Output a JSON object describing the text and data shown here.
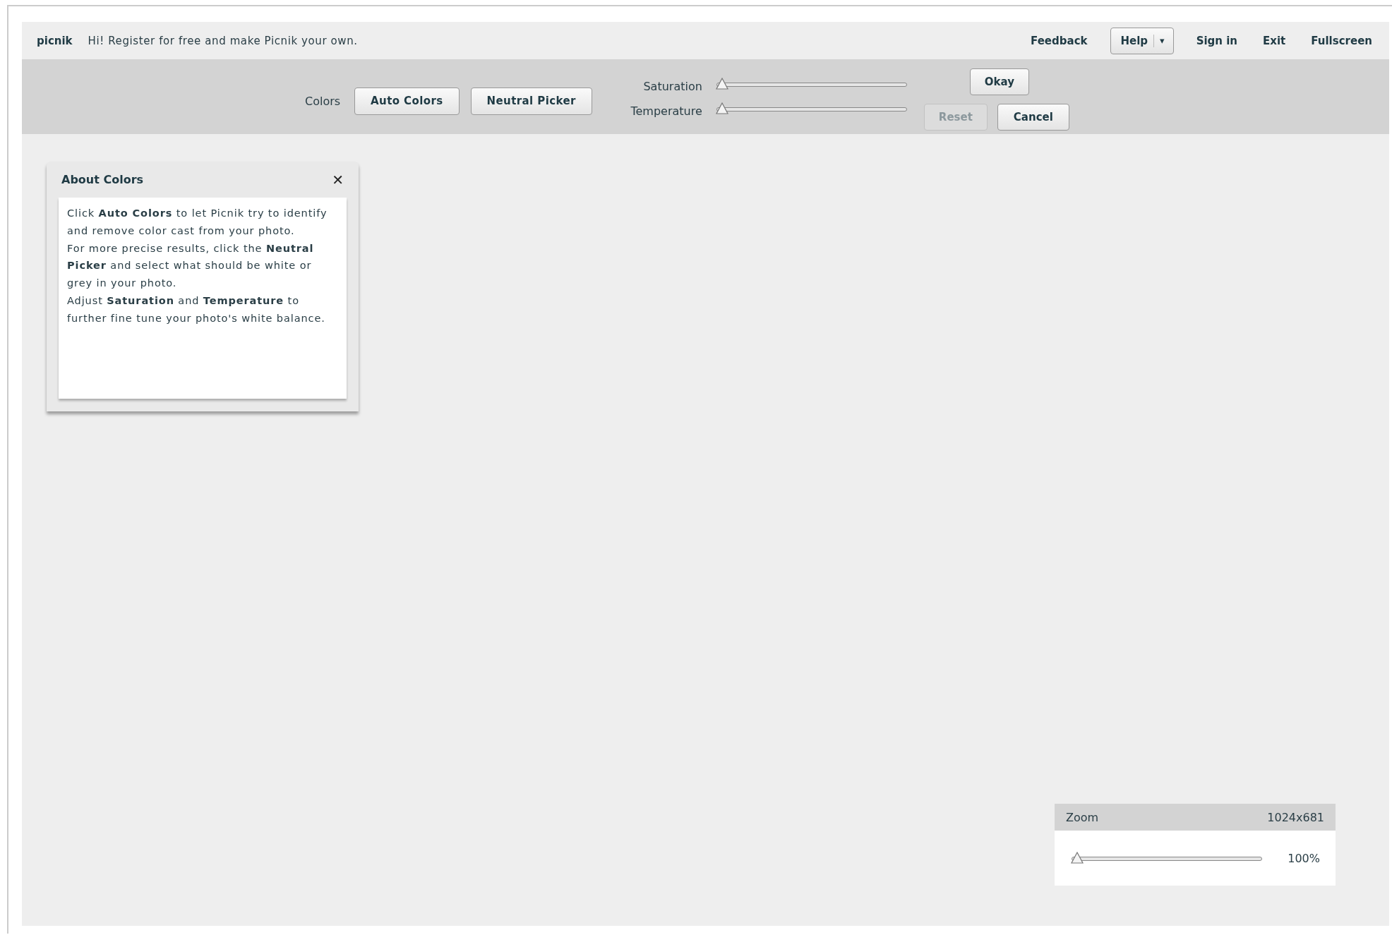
{
  "topbar": {
    "logo": "picnik",
    "message": "Hi! Register for free and make Picnik your own.",
    "links": [
      {
        "kind": "link",
        "label": "Feedback"
      },
      {
        "kind": "dropdown",
        "label": "Help",
        "caret": "▾"
      },
      {
        "kind": "link",
        "label": "Sign in"
      },
      {
        "kind": "link",
        "label": "Exit"
      },
      {
        "kind": "link",
        "label": "Fullscreen"
      }
    ]
  },
  "toolbar": {
    "label": "Colors",
    "buttons": [
      {
        "label": "Auto Colors"
      },
      {
        "label": "Neutral Picker"
      }
    ],
    "sliders": [
      {
        "label": "Saturation",
        "level": 0
      },
      {
        "label": "Temperature",
        "level": 0
      }
    ],
    "okay": {
      "label": "Okay",
      "disabled": false
    },
    "reset": {
      "label": "Reset",
      "disabled": true
    },
    "cancel": {
      "label": "Cancel",
      "disabled": false
    }
  },
  "about_panel": {
    "title": "About Colors",
    "close": "✕",
    "paragraphs": [
      "Click **Auto Colors** to let Picnik try to identify and remove color cast from your photo.",
      "For more precise results, click the **Neutral Picker** and select what should be white or grey in your photo.",
      "Adjust **Saturation** and **Temperature** to further fine tune your photo's white balance."
    ]
  },
  "zoom_panel": {
    "title": "Zoom",
    "dimensions": "1024x681",
    "level": 0,
    "reading": "100%"
  }
}
